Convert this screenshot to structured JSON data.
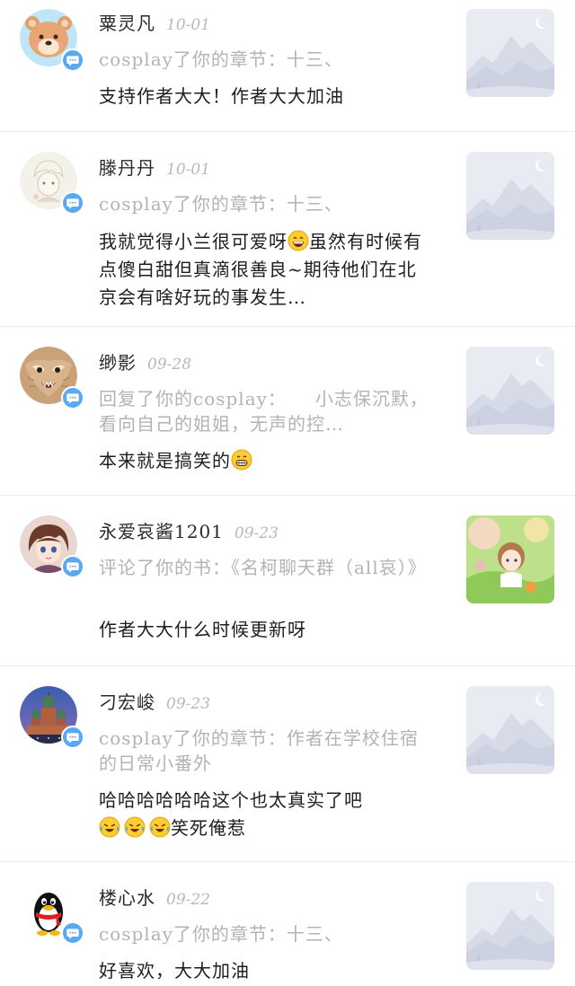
{
  "items": [
    {
      "name": "粟灵凡",
      "date": "10-01",
      "context": "cosplay了你的章节：十三、",
      "comment": "支持作者大大！作者大大加油",
      "avatar": "bear-avatar",
      "thumbnail": "placeholder-mountain"
    },
    {
      "name": "滕丹丹",
      "date": "10-01",
      "context": "cosplay了你的章节：十三、",
      "comment_before_emoji": "我就觉得小兰很可爱呀",
      "comment_emoji": "grinning-face-emoji",
      "comment_after_emoji": "虽然有时候有点傻白甜但真滴很善良~期待他们在北京会有啥好玩的事发生…",
      "avatar": "anime-boy-sketch-avatar",
      "thumbnail": "placeholder-mountain"
    },
    {
      "name": "缈影",
      "date": "09-28",
      "context": "回复了你的cosplay：　　小志保沉默，看向自己的姐姐，无声的控…",
      "comment": "本来就是搞笑的",
      "comment_emoji": "grimacing-face-emoji",
      "avatar": "owl-avatar",
      "thumbnail": "placeholder-mountain"
    },
    {
      "name": "永爱哀酱1201",
      "date": "09-23",
      "context": "评论了你的书：《名柯聊天群（all哀）》",
      "comment": "作者大大什么时候更新呀",
      "avatar": "anime-girl-avatar",
      "thumbnail": "book-cover-illustration"
    },
    {
      "name": "刁宏峻",
      "date": "09-23",
      "context": "cosplay了你的章节：作者在学校住宿的日常小番外",
      "comment_line1": "哈哈哈哈哈哈这个也太真实了吧",
      "comment_line2_emojis": [
        "rofl-emoji",
        "rofl-emoji",
        "rofl-emoji"
      ],
      "comment_line2_text": "笑死俺惹",
      "avatar": "cathedral-avatar",
      "thumbnail": "placeholder-mountain"
    },
    {
      "name": "楼心水",
      "date": "09-22",
      "context": "cosplay了你的章节：十三、",
      "comment": "好喜欢，大大加油",
      "avatar": "qq-penguin-avatar",
      "thumbnail": "placeholder-mountain"
    }
  ],
  "colors": {
    "badge": "#5aa8f0",
    "context_text": "#b3b3b3",
    "date_text": "#b9b9b9",
    "divider": "#ececec",
    "thumb_bg": "#e9ebf3"
  }
}
